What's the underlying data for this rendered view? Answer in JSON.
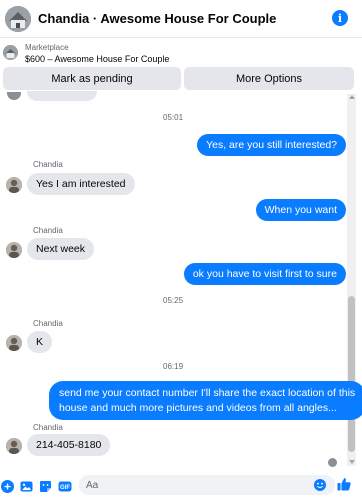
{
  "header": {
    "title": "Chandia · Awesome House For Couple",
    "info_icon": "info-icon"
  },
  "marketplace": {
    "label": "Marketplace",
    "item": "$600 – Awesome House For Couple"
  },
  "actions": {
    "mark_pending": "Mark as pending",
    "more_options": "More Options"
  },
  "conversation": {
    "timestamps": [
      "05:01",
      "05:25",
      "06:19"
    ],
    "sender_name": "Chandia",
    "messages": [
      {
        "from": "me",
        "text": "Yes, are you still interested?"
      },
      {
        "from": "them",
        "text": "Yes I am interested"
      },
      {
        "from": "me",
        "text": "When you want"
      },
      {
        "from": "them",
        "text": "Next week"
      },
      {
        "from": "me",
        "text": "ok you have to visit first to sure"
      },
      {
        "from": "them",
        "text": "K"
      },
      {
        "from": "me",
        "lines": [
          "send me your contact number I'll share the exact location of this",
          "house and much more pictures and videos from all angles..."
        ]
      },
      {
        "from": "them",
        "text": "214-405-8180"
      }
    ]
  },
  "composer": {
    "placeholder": "Aa",
    "value": "",
    "icons": [
      "plus-icon",
      "photo-icon",
      "sticker-icon",
      "gif-icon",
      "emoji-icon",
      "like-icon"
    ],
    "gif_label": "GIF"
  },
  "colors": {
    "accent": "#0a7cff",
    "incoming_bubble": "#e4e6eb",
    "muted_text": "#65676b"
  }
}
